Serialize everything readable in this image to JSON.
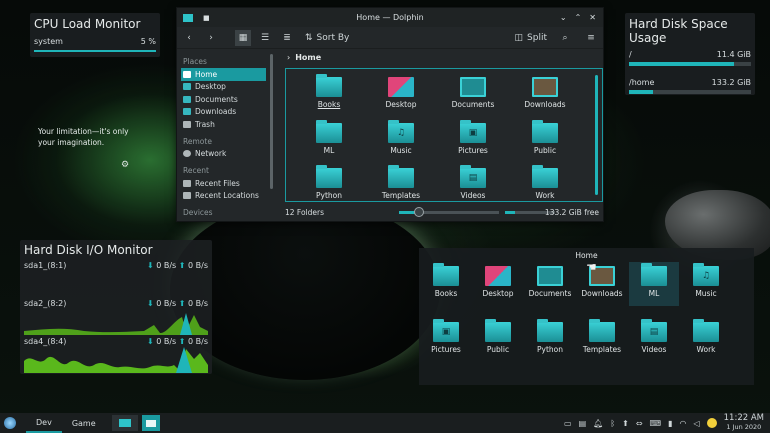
{
  "cpu_widget": {
    "title": "CPU Load Monitor",
    "label": "system",
    "value": "5 %",
    "level": 0.05
  },
  "desktop_note": {
    "line1": "Your limitation—it's only",
    "line2": "your imagination."
  },
  "disk_space": {
    "title": "Hard Disk Space Usage",
    "items": [
      {
        "label": "/",
        "value": "11.4 GiB",
        "fill": 0.86
      },
      {
        "label": "/home",
        "value": "133.2 GiB",
        "fill": 0.2
      }
    ]
  },
  "disk_io": {
    "title": "Hard Disk I/O Monitor",
    "items": [
      {
        "label": "sda1_(8:1)",
        "read": "0 B/s",
        "write": "0 B/s"
      },
      {
        "label": "sda2_(8:2)",
        "read": "0 B/s",
        "write": "0 B/s"
      },
      {
        "label": "sda4_(8:4)",
        "read": "0 B/s",
        "write": "0 B/s"
      }
    ]
  },
  "dolphin": {
    "title": "Home — Dolphin",
    "toolbar": {
      "sort_label": "Sort By",
      "split_label": "Split"
    },
    "sidebar": {
      "places_title": "Places",
      "places": [
        "Home",
        "Desktop",
        "Documents",
        "Downloads",
        "Trash"
      ],
      "remote_title": "Remote",
      "remote": [
        "Network"
      ],
      "recent_title": "Recent",
      "recent": [
        "Recent Files",
        "Recent Locations"
      ],
      "devices_title": "Devices"
    },
    "breadcrumb": "Home",
    "files": [
      "Books",
      "Desktop",
      "Documents",
      "Downloads",
      "ML",
      "Music",
      "Pictures",
      "Public",
      "Python",
      "Templates",
      "Videos",
      "Work"
    ],
    "status": {
      "count": "12 Folders",
      "free": "133.2 GiB free",
      "zoom_level": 0.2,
      "used_fill": 0.2
    }
  },
  "launcher": {
    "title": "Home",
    "items": [
      "Books",
      "Desktop",
      "Documents",
      "Downloads",
      "ML",
      "Music",
      "Pictures",
      "Public",
      "Python",
      "Templates",
      "Videos",
      "Work"
    ]
  },
  "taskbar": {
    "tasks": [
      "Dev",
      "Game"
    ],
    "clock_time": "11:22 AM",
    "clock_date": "1 Jun 2020"
  },
  "colors": {
    "accent": "#1a9aa0",
    "folder": "#2ec3c9",
    "io_graph": "#6ed41e"
  }
}
